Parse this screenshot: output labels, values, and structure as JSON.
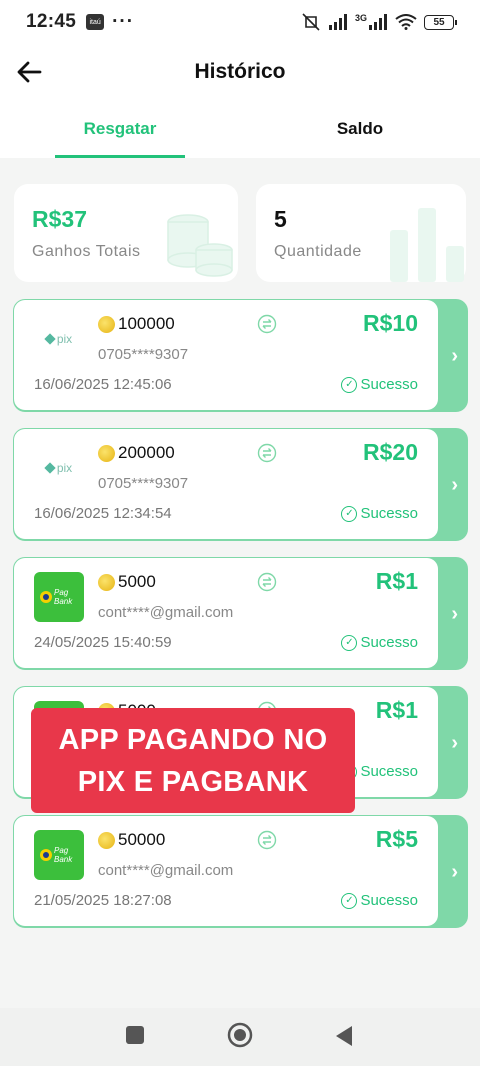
{
  "statusbar": {
    "time": "12:45",
    "bank_badge": "itaú",
    "dots": "···",
    "network": "3G",
    "battery": "55"
  },
  "header": {
    "title": "Histórico"
  },
  "tabs": [
    {
      "label": "Resgatar",
      "active": true
    },
    {
      "label": "Saldo",
      "active": false
    }
  ],
  "summary": {
    "earnings": {
      "value": "R$37",
      "label": "Ganhos Totais"
    },
    "quantity": {
      "value": "5",
      "label": "Quantidade"
    }
  },
  "records": [
    {
      "method": "pix",
      "amount": "100000",
      "account": "0705****9307",
      "price": "R$10",
      "date": "16/06/2025 12:45:06",
      "status": "Sucesso"
    },
    {
      "method": "pix",
      "amount": "200000",
      "account": "0705****9307",
      "price": "R$20",
      "date": "16/06/2025 12:34:54",
      "status": "Sucesso"
    },
    {
      "method": "pagbank",
      "amount": "5000",
      "account": "cont****@gmail.com",
      "price": "R$1",
      "date": "24/05/2025 15:40:59",
      "status": "Sucesso"
    },
    {
      "method": "pagbank",
      "amount": "5000",
      "account": "",
      "price": "R$1",
      "date": "",
      "status": "Sucesso"
    },
    {
      "method": "pagbank",
      "amount": "50000",
      "account": "cont****@gmail.com",
      "price": "R$5",
      "date": "21/05/2025 18:27:08",
      "status": "Sucesso"
    }
  ],
  "logos": {
    "pix": "pix",
    "pagbank_line1": "Pag",
    "pagbank_line2": "Bank"
  },
  "banner": {
    "line1": "APP PAGANDO NO",
    "line2": "PIX E PAGBANK"
  },
  "colors": {
    "accent": "#22c27a",
    "card_side": "#7fd8a8",
    "banner": "#e8374a"
  }
}
